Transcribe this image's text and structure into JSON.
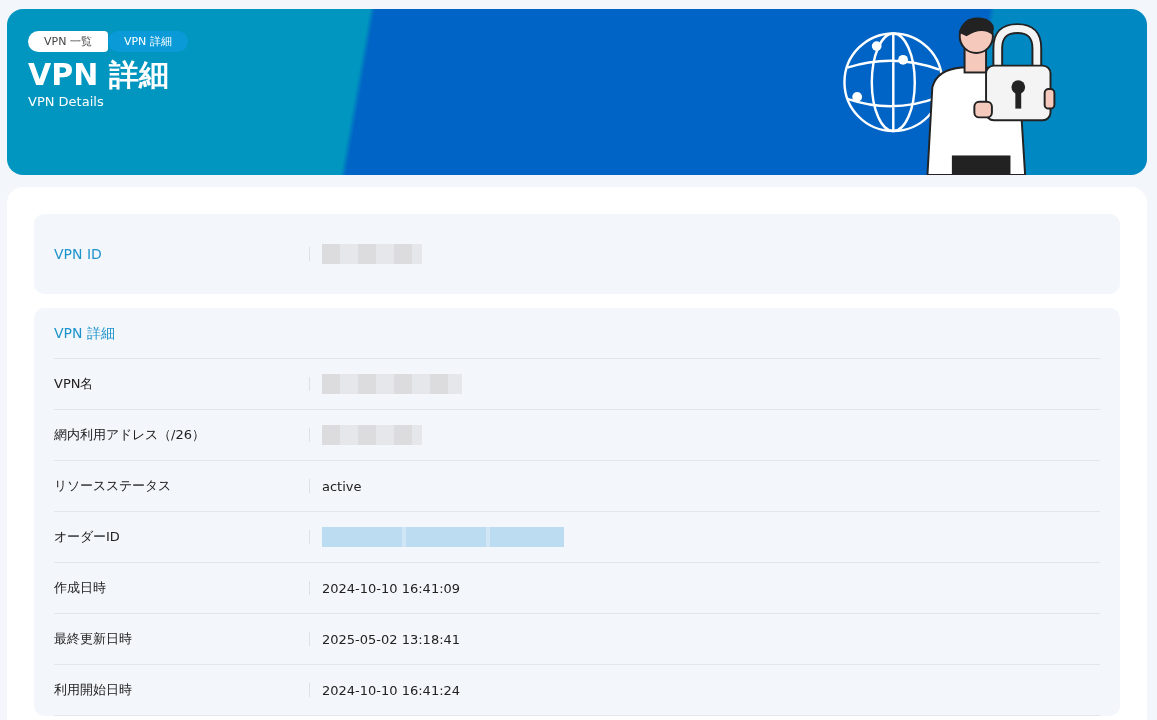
{
  "breadcrumb": [
    {
      "label": "VPN 一覧",
      "selected": false
    },
    {
      "label": "VPN 詳細",
      "selected": true
    }
  ],
  "header": {
    "title": "VPN 詳細",
    "subtitle": "VPN Details"
  },
  "id_section": {
    "label": "VPN ID",
    "value": {
      "kind": "redacted",
      "link": false
    }
  },
  "details": {
    "title": "VPN 詳細",
    "rows": [
      {
        "label": "VPN名",
        "value": {
          "kind": "redacted",
          "link": false
        }
      },
      {
        "label": "網内利用アドレス（/26）",
        "value": {
          "kind": "redacted",
          "link": false
        }
      },
      {
        "label": "リソースステータス",
        "value": {
          "kind": "text",
          "text": "active"
        }
      },
      {
        "label": "オーダーID",
        "value": {
          "kind": "redacted",
          "link": true
        }
      },
      {
        "label": "作成日時",
        "value": {
          "kind": "text",
          "text": "2024-10-10 16:41:09"
        }
      },
      {
        "label": "最終更新日時",
        "value": {
          "kind": "text",
          "text": "2025-05-02 13:18:41"
        }
      },
      {
        "label": "利用開始日時",
        "value": {
          "kind": "text",
          "text": "2024-10-10 16:41:24"
        }
      }
    ]
  }
}
